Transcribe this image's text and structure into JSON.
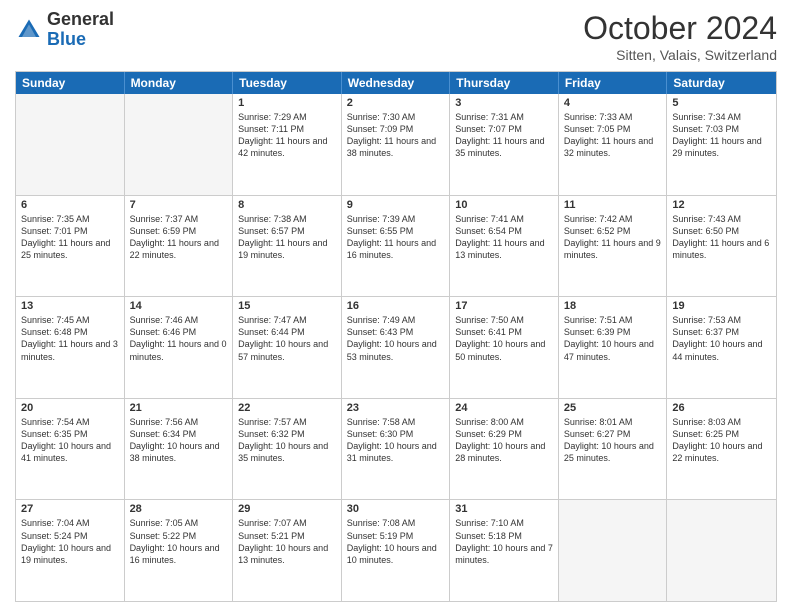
{
  "header": {
    "logo": {
      "general": "General",
      "blue": "Blue"
    },
    "title": "October 2024",
    "location": "Sitten, Valais, Switzerland"
  },
  "calendar": {
    "days": [
      "Sunday",
      "Monday",
      "Tuesday",
      "Wednesday",
      "Thursday",
      "Friday",
      "Saturday"
    ],
    "rows": [
      [
        {
          "day": "",
          "empty": true
        },
        {
          "day": "",
          "empty": true
        },
        {
          "day": "1",
          "sunrise": "Sunrise: 7:29 AM",
          "sunset": "Sunset: 7:11 PM",
          "daylight": "Daylight: 11 hours and 42 minutes."
        },
        {
          "day": "2",
          "sunrise": "Sunrise: 7:30 AM",
          "sunset": "Sunset: 7:09 PM",
          "daylight": "Daylight: 11 hours and 38 minutes."
        },
        {
          "day": "3",
          "sunrise": "Sunrise: 7:31 AM",
          "sunset": "Sunset: 7:07 PM",
          "daylight": "Daylight: 11 hours and 35 minutes."
        },
        {
          "day": "4",
          "sunrise": "Sunrise: 7:33 AM",
          "sunset": "Sunset: 7:05 PM",
          "daylight": "Daylight: 11 hours and 32 minutes."
        },
        {
          "day": "5",
          "sunrise": "Sunrise: 7:34 AM",
          "sunset": "Sunset: 7:03 PM",
          "daylight": "Daylight: 11 hours and 29 minutes."
        }
      ],
      [
        {
          "day": "6",
          "sunrise": "Sunrise: 7:35 AM",
          "sunset": "Sunset: 7:01 PM",
          "daylight": "Daylight: 11 hours and 25 minutes."
        },
        {
          "day": "7",
          "sunrise": "Sunrise: 7:37 AM",
          "sunset": "Sunset: 6:59 PM",
          "daylight": "Daylight: 11 hours and 22 minutes."
        },
        {
          "day": "8",
          "sunrise": "Sunrise: 7:38 AM",
          "sunset": "Sunset: 6:57 PM",
          "daylight": "Daylight: 11 hours and 19 minutes."
        },
        {
          "day": "9",
          "sunrise": "Sunrise: 7:39 AM",
          "sunset": "Sunset: 6:55 PM",
          "daylight": "Daylight: 11 hours and 16 minutes."
        },
        {
          "day": "10",
          "sunrise": "Sunrise: 7:41 AM",
          "sunset": "Sunset: 6:54 PM",
          "daylight": "Daylight: 11 hours and 13 minutes."
        },
        {
          "day": "11",
          "sunrise": "Sunrise: 7:42 AM",
          "sunset": "Sunset: 6:52 PM",
          "daylight": "Daylight: 11 hours and 9 minutes."
        },
        {
          "day": "12",
          "sunrise": "Sunrise: 7:43 AM",
          "sunset": "Sunset: 6:50 PM",
          "daylight": "Daylight: 11 hours and 6 minutes."
        }
      ],
      [
        {
          "day": "13",
          "sunrise": "Sunrise: 7:45 AM",
          "sunset": "Sunset: 6:48 PM",
          "daylight": "Daylight: 11 hours and 3 minutes."
        },
        {
          "day": "14",
          "sunrise": "Sunrise: 7:46 AM",
          "sunset": "Sunset: 6:46 PM",
          "daylight": "Daylight: 11 hours and 0 minutes."
        },
        {
          "day": "15",
          "sunrise": "Sunrise: 7:47 AM",
          "sunset": "Sunset: 6:44 PM",
          "daylight": "Daylight: 10 hours and 57 minutes."
        },
        {
          "day": "16",
          "sunrise": "Sunrise: 7:49 AM",
          "sunset": "Sunset: 6:43 PM",
          "daylight": "Daylight: 10 hours and 53 minutes."
        },
        {
          "day": "17",
          "sunrise": "Sunrise: 7:50 AM",
          "sunset": "Sunset: 6:41 PM",
          "daylight": "Daylight: 10 hours and 50 minutes."
        },
        {
          "day": "18",
          "sunrise": "Sunrise: 7:51 AM",
          "sunset": "Sunset: 6:39 PM",
          "daylight": "Daylight: 10 hours and 47 minutes."
        },
        {
          "day": "19",
          "sunrise": "Sunrise: 7:53 AM",
          "sunset": "Sunset: 6:37 PM",
          "daylight": "Daylight: 10 hours and 44 minutes."
        }
      ],
      [
        {
          "day": "20",
          "sunrise": "Sunrise: 7:54 AM",
          "sunset": "Sunset: 6:35 PM",
          "daylight": "Daylight: 10 hours and 41 minutes."
        },
        {
          "day": "21",
          "sunrise": "Sunrise: 7:56 AM",
          "sunset": "Sunset: 6:34 PM",
          "daylight": "Daylight: 10 hours and 38 minutes."
        },
        {
          "day": "22",
          "sunrise": "Sunrise: 7:57 AM",
          "sunset": "Sunset: 6:32 PM",
          "daylight": "Daylight: 10 hours and 35 minutes."
        },
        {
          "day": "23",
          "sunrise": "Sunrise: 7:58 AM",
          "sunset": "Sunset: 6:30 PM",
          "daylight": "Daylight: 10 hours and 31 minutes."
        },
        {
          "day": "24",
          "sunrise": "Sunrise: 8:00 AM",
          "sunset": "Sunset: 6:29 PM",
          "daylight": "Daylight: 10 hours and 28 minutes."
        },
        {
          "day": "25",
          "sunrise": "Sunrise: 8:01 AM",
          "sunset": "Sunset: 6:27 PM",
          "daylight": "Daylight: 10 hours and 25 minutes."
        },
        {
          "day": "26",
          "sunrise": "Sunrise: 8:03 AM",
          "sunset": "Sunset: 6:25 PM",
          "daylight": "Daylight: 10 hours and 22 minutes."
        }
      ],
      [
        {
          "day": "27",
          "sunrise": "Sunrise: 7:04 AM",
          "sunset": "Sunset: 5:24 PM",
          "daylight": "Daylight: 10 hours and 19 minutes."
        },
        {
          "day": "28",
          "sunrise": "Sunrise: 7:05 AM",
          "sunset": "Sunset: 5:22 PM",
          "daylight": "Daylight: 10 hours and 16 minutes."
        },
        {
          "day": "29",
          "sunrise": "Sunrise: 7:07 AM",
          "sunset": "Sunset: 5:21 PM",
          "daylight": "Daylight: 10 hours and 13 minutes."
        },
        {
          "day": "30",
          "sunrise": "Sunrise: 7:08 AM",
          "sunset": "Sunset: 5:19 PM",
          "daylight": "Daylight: 10 hours and 10 minutes."
        },
        {
          "day": "31",
          "sunrise": "Sunrise: 7:10 AM",
          "sunset": "Sunset: 5:18 PM",
          "daylight": "Daylight: 10 hours and 7 minutes."
        },
        {
          "day": "",
          "empty": true
        },
        {
          "day": "",
          "empty": true
        }
      ]
    ]
  }
}
